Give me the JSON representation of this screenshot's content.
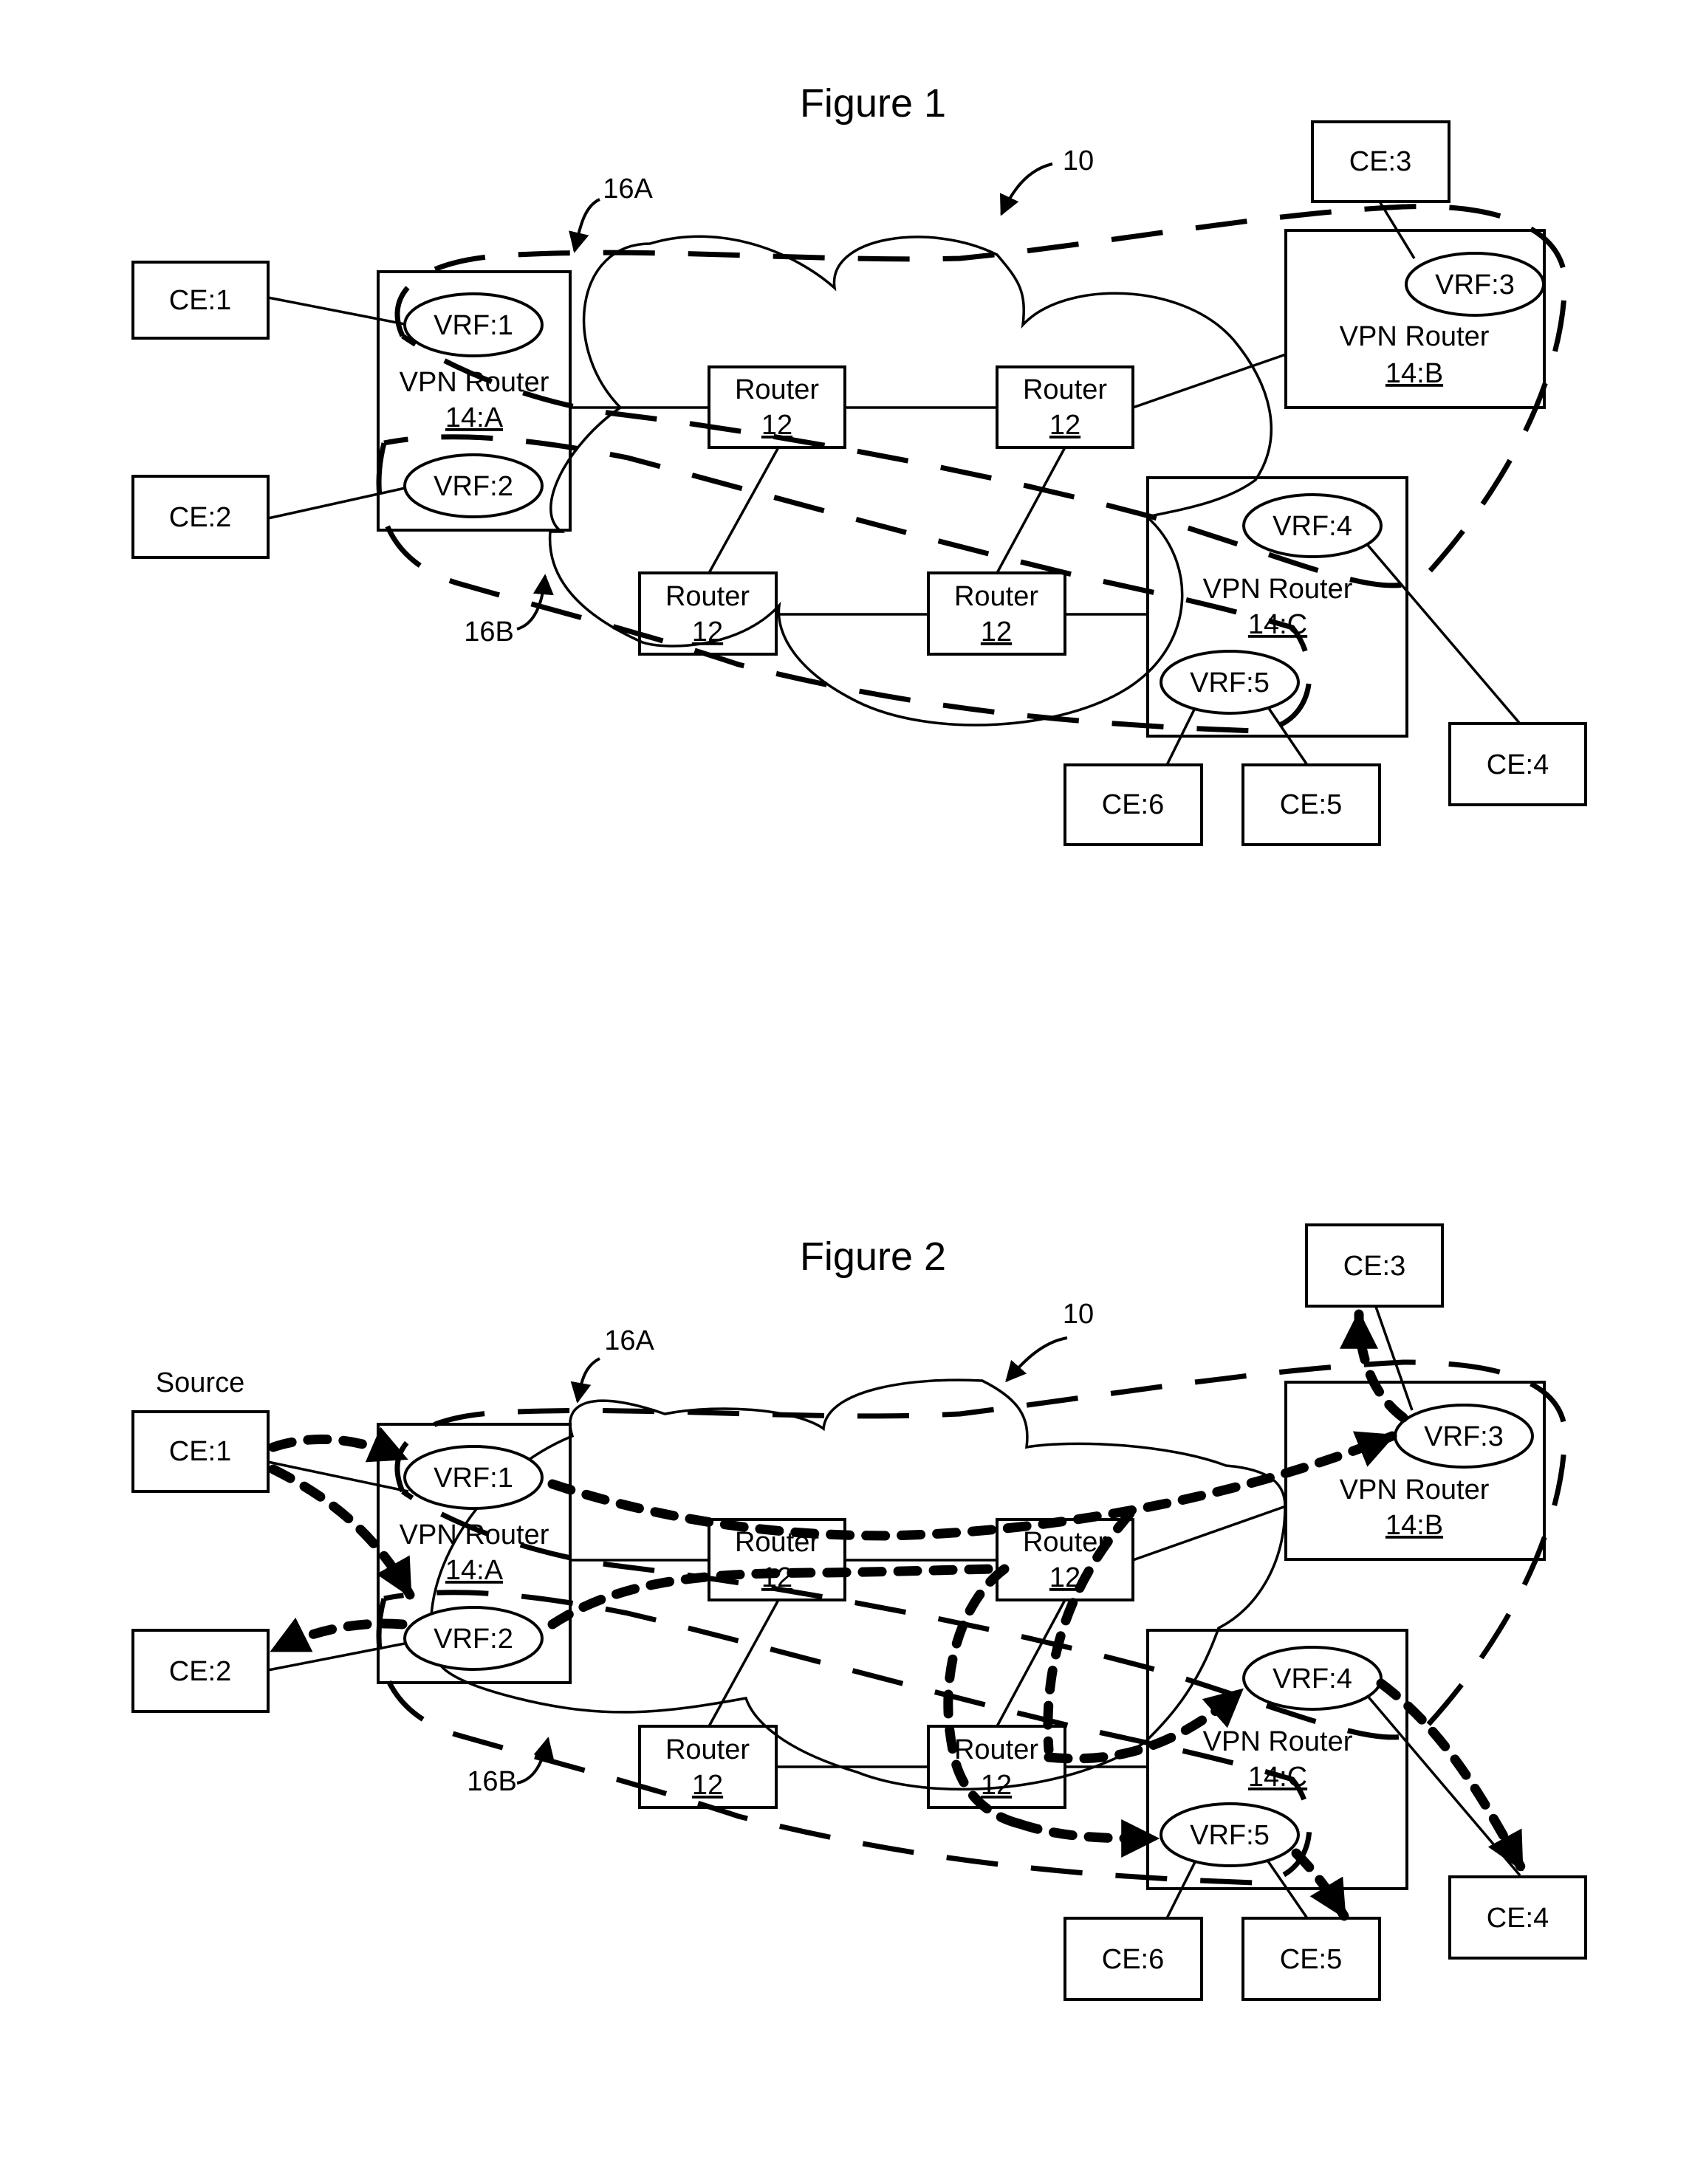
{
  "figures": [
    {
      "title": "Figure 1",
      "network_ref": "10",
      "vpn_a_ref": "16A",
      "vpn_b_ref": "16B",
      "ce": {
        "ce1": "CE:1",
        "ce2": "CE:2",
        "ce3": "CE:3",
        "ce4": "CE:4",
        "ce5": "CE:5",
        "ce6": "CE:6"
      },
      "vpn_routers": {
        "a": {
          "label": "VPN Router",
          "id": "14:A"
        },
        "b": {
          "label": "VPN Router",
          "id": "14:B"
        },
        "c": {
          "label": "VPN Router",
          "id": "14:C"
        }
      },
      "vrfs": {
        "vrf1": "VRF:1",
        "vrf2": "VRF:2",
        "vrf3": "VRF:3",
        "vrf4": "VRF:4",
        "vrf5": "VRF:5"
      },
      "routers": [
        {
          "label": "Router",
          "id": "12"
        },
        {
          "label": "Router",
          "id": "12"
        },
        {
          "label": "Router",
          "id": "12"
        },
        {
          "label": "Router",
          "id": "12"
        }
      ]
    },
    {
      "title": "Figure 2",
      "source_label": "Source",
      "network_ref": "10",
      "vpn_a_ref": "16A",
      "vpn_b_ref": "16B",
      "ce": {
        "ce1": "CE:1",
        "ce2": "CE:2",
        "ce3": "CE:3",
        "ce4": "CE:4",
        "ce5": "CE:5",
        "ce6": "CE:6"
      },
      "vpn_routers": {
        "a": {
          "label": "VPN Router",
          "id": "14:A"
        },
        "b": {
          "label": "VPN Router",
          "id": "14:B"
        },
        "c": {
          "label": "VPN Router",
          "id": "14:C"
        }
      },
      "vrfs": {
        "vrf1": "VRF:1",
        "vrf2": "VRF:2",
        "vrf3": "VRF:3",
        "vrf4": "VRF:4",
        "vrf5": "VRF:5"
      },
      "routers": [
        {
          "label": "Router",
          "id": "12"
        },
        {
          "label": "Router",
          "id": "12"
        },
        {
          "label": "Router",
          "id": "12"
        },
        {
          "label": "Router",
          "id": "12"
        }
      ]
    }
  ]
}
